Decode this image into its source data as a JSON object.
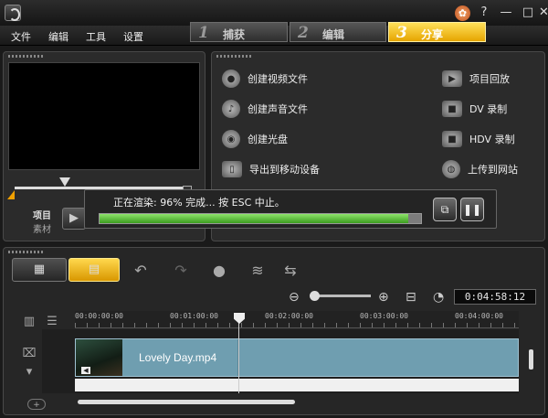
{
  "menu": {
    "file": "文件",
    "edit": "编辑",
    "tools": "工具",
    "settings": "设置"
  },
  "steps": [
    {
      "num": "1",
      "label": "捕获"
    },
    {
      "num": "2",
      "label": "编辑"
    },
    {
      "num": "3",
      "label": "分享"
    }
  ],
  "preview": {
    "project_label": "项目",
    "clip_label": "素材"
  },
  "share": {
    "left": [
      "创建视频文件",
      "创建声音文件",
      "创建光盘",
      "导出到移动设备"
    ],
    "right": [
      "项目回放",
      "DV 录制",
      "HDV 录制",
      "上传到网站"
    ]
  },
  "render": {
    "status": "正在渲染: 96% 完成... 按 ESC 中止。",
    "progress": 0.96
  },
  "timeline": {
    "timecode": "0:04:58:12",
    "ruler": [
      "00:00:00:00",
      "00:01:00:00",
      "00:02:00:00",
      "00:03:00:00",
      "00:04:00:00"
    ],
    "clip_name": "Lovely Day.mp4"
  },
  "icons": {
    "film": "film-icon",
    "storyboard": "storyboard-icon",
    "undo": "undo-icon",
    "redo": "redo-icon",
    "record": "record-icon",
    "audio_wave": "audio-wave-icon",
    "smart_mix": "smart-mix-icon",
    "zoom_out": "zoom-out-icon",
    "zoom_in": "zoom-in-icon",
    "fit": "fit-to-window-icon",
    "clock": "clock-icon"
  },
  "colors": {
    "accent": "#F0B000",
    "progress": "#55B837",
    "clip": "#6F9EB0"
  }
}
